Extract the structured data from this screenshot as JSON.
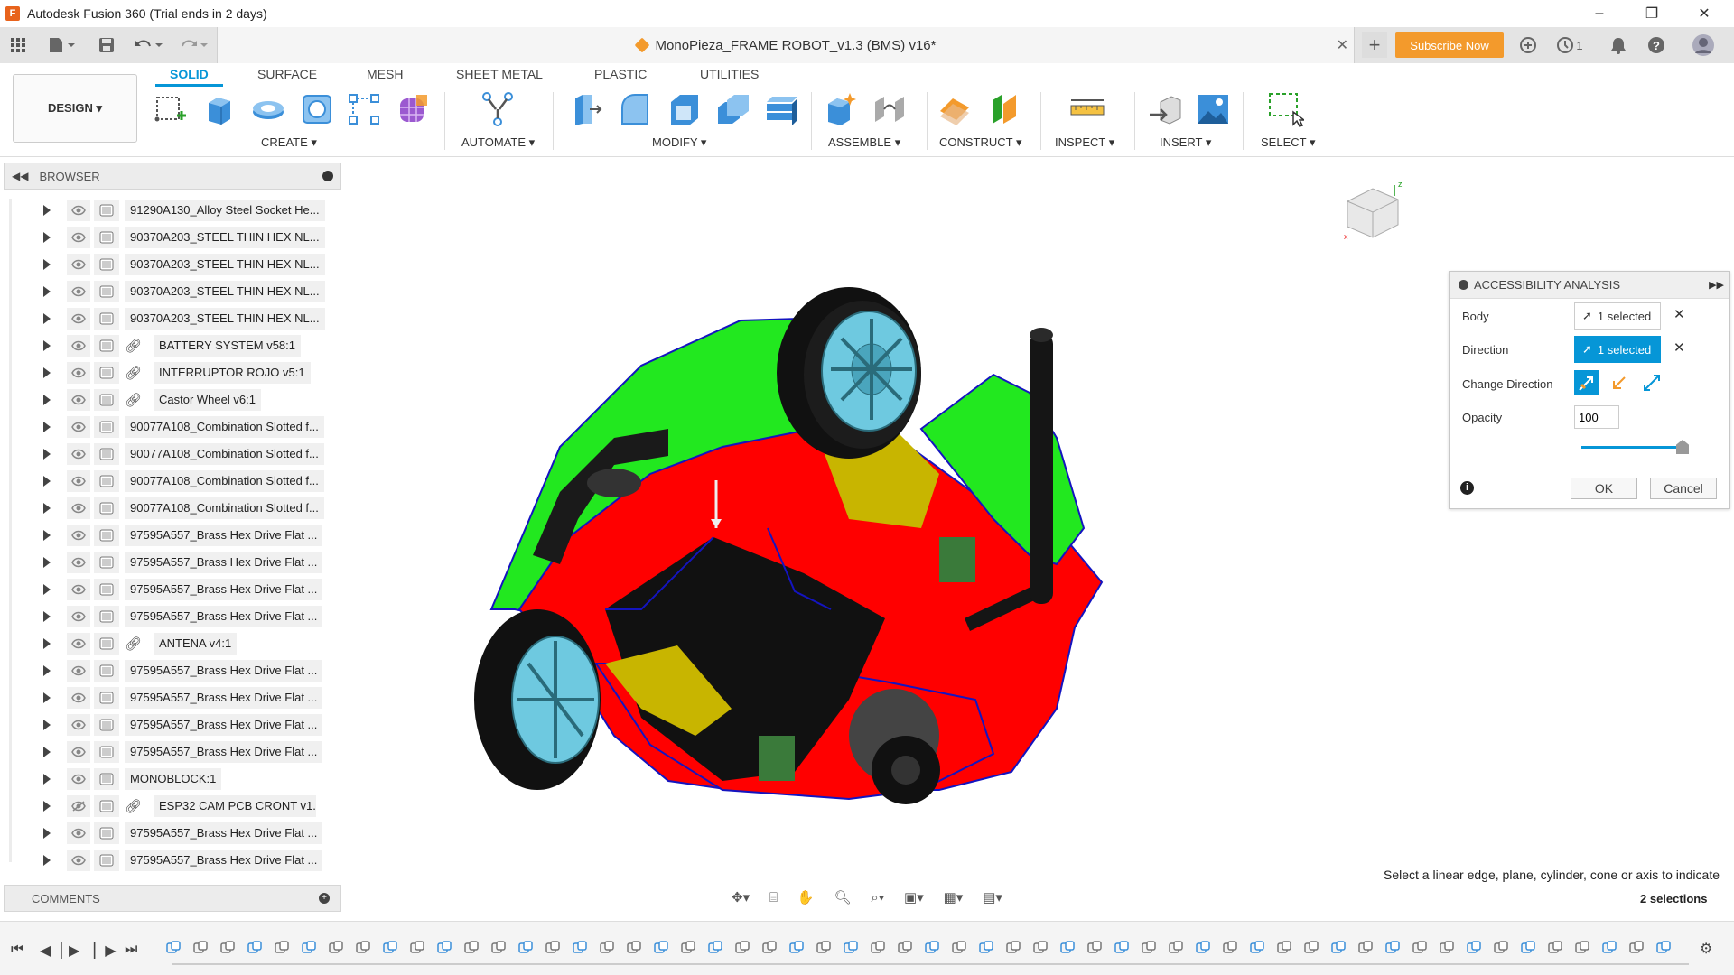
{
  "window": {
    "title": "Autodesk Fusion 360 (Trial ends in 2 days)",
    "app_icon": "F",
    "minimize": "–",
    "restore": "❐",
    "close": "✕"
  },
  "document": {
    "title": "MonoPieza_FRAME ROBOT_v1.3 (BMS) v16*",
    "close": "✕"
  },
  "header": {
    "subscribe_label": "Subscribe Now",
    "jobs_count": "1",
    "new_tab": "+"
  },
  "toolbar": {
    "workspace_label": "DESIGN ▾",
    "tabs": [
      "SOLID",
      "SURFACE",
      "MESH",
      "SHEET METAL",
      "PLASTIC",
      "UTILITIES"
    ],
    "groups": [
      "CREATE ▾",
      "AUTOMATE ▾",
      "MODIFY ▾",
      "ASSEMBLE ▾",
      "CONSTRUCT ▾",
      "INSPECT ▾",
      "INSERT ▾",
      "SELECT ▾"
    ]
  },
  "browser": {
    "title": "BROWSER",
    "items": [
      {
        "label": "91290A130_Alloy Steel Socket He...",
        "link": false,
        "hidden": false
      },
      {
        "label": "90370A203_STEEL THIN HEX NL...",
        "link": false,
        "hidden": false
      },
      {
        "label": "90370A203_STEEL THIN HEX NL...",
        "link": false,
        "hidden": false
      },
      {
        "label": "90370A203_STEEL THIN HEX NL...",
        "link": false,
        "hidden": false
      },
      {
        "label": "90370A203_STEEL THIN HEX NL...",
        "link": false,
        "hidden": false
      },
      {
        "label": "BATTERY SYSTEM v58:1",
        "link": true,
        "hidden": false
      },
      {
        "label": "INTERRUPTOR ROJO v5:1",
        "link": true,
        "hidden": false
      },
      {
        "label": "Castor Wheel v6:1",
        "link": true,
        "hidden": false
      },
      {
        "label": "90077A108_Combination Slotted f...",
        "link": false,
        "hidden": false
      },
      {
        "label": "90077A108_Combination Slotted f...",
        "link": false,
        "hidden": false
      },
      {
        "label": "90077A108_Combination Slotted f...",
        "link": false,
        "hidden": false
      },
      {
        "label": "90077A108_Combination Slotted f...",
        "link": false,
        "hidden": false
      },
      {
        "label": "97595A557_Brass Hex Drive Flat ...",
        "link": false,
        "hidden": false
      },
      {
        "label": "97595A557_Brass Hex Drive Flat ...",
        "link": false,
        "hidden": false
      },
      {
        "label": "97595A557_Brass Hex Drive Flat ...",
        "link": false,
        "hidden": false
      },
      {
        "label": "97595A557_Brass Hex Drive Flat ...",
        "link": false,
        "hidden": false
      },
      {
        "label": "ANTENA v4:1",
        "link": true,
        "hidden": false
      },
      {
        "label": "97595A557_Brass Hex Drive Flat ...",
        "link": false,
        "hidden": false
      },
      {
        "label": "97595A557_Brass Hex Drive Flat ...",
        "link": false,
        "hidden": false
      },
      {
        "label": "97595A557_Brass Hex Drive Flat ...",
        "link": false,
        "hidden": false
      },
      {
        "label": "97595A557_Brass Hex Drive Flat ...",
        "link": false,
        "hidden": false
      },
      {
        "label": "MONOBLOCK:1",
        "link": false,
        "hidden": false
      },
      {
        "label": "ESP32 CAM PCB CRONT v1...",
        "link": true,
        "hidden": true
      },
      {
        "label": "97595A557_Brass Hex Drive Flat ...",
        "link": false,
        "hidden": false
      },
      {
        "label": "97595A557_Brass Hex Drive Flat ...",
        "link": false,
        "hidden": false
      }
    ]
  },
  "comments": {
    "title": "COMMENTS"
  },
  "dialog": {
    "title": "ACCESSIBILITY ANALYSIS",
    "body_label": "Body",
    "body_value": "1 selected",
    "direction_label": "Direction",
    "direction_value": "1 selected",
    "change_direction_label": "Change Direction",
    "opacity_label": "Opacity",
    "opacity_value": "100",
    "opacity_fraction": 1.0,
    "ok_label": "OK",
    "cancel_label": "Cancel"
  },
  "status": {
    "hint": "Select a linear edge, plane, cylinder, cone or axis to indicate",
    "selections": "2 selections"
  },
  "colors": {
    "accent": "#0696d7",
    "subscribe": "#f39a2c",
    "body_red": "#ff0000",
    "face_green": "#22e81f",
    "wheel_cyan": "#6ec9e0"
  }
}
